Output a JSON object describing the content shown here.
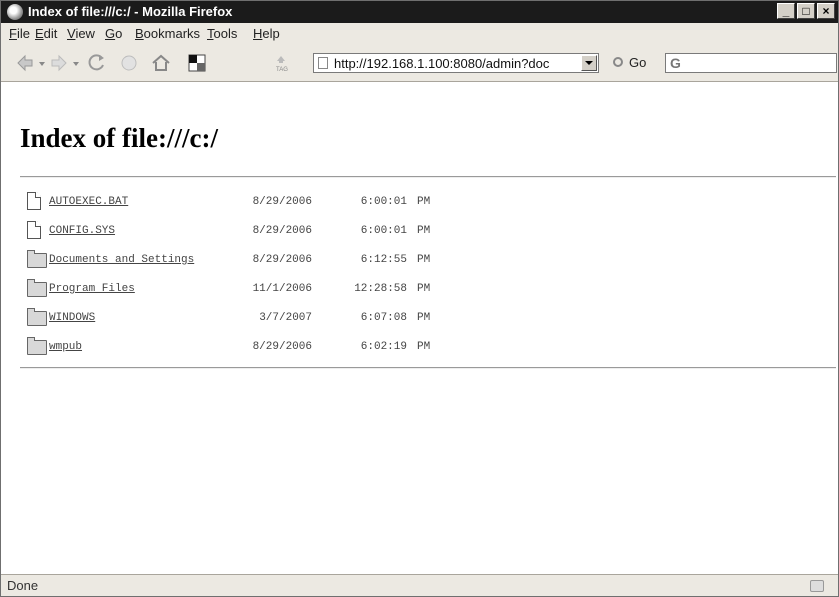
{
  "window": {
    "title": "Index of file:///c:/ - Mozilla Firefox",
    "controls": [
      "_",
      "□",
      "×"
    ]
  },
  "menubar": {
    "items": [
      {
        "first": "F",
        "rest": "ile"
      },
      {
        "first": "E",
        "rest": "dit"
      },
      {
        "first": "V",
        "rest": "iew"
      },
      {
        "first": "G",
        "rest": "o"
      },
      {
        "first": "B",
        "rest": "ookmarks"
      },
      {
        "first": "T",
        "rest": "ools"
      },
      {
        "first": "H",
        "rest": "elp"
      }
    ]
  },
  "navbar": {
    "url": "http://192.168.1.100:8080/admin?doc",
    "go_label": "Go",
    "search_glyph": "G",
    "tag_icon_label": "TAG"
  },
  "page": {
    "title": "Index of file:///c:/",
    "entries": [
      {
        "type": "file",
        "name": "AUTOEXEC.BAT",
        "date": "8/29/2006",
        "time": "6:00:01",
        "ampm": "PM"
      },
      {
        "type": "file",
        "name": "CONFIG.SYS",
        "date": "8/29/2006",
        "time": "6:00:01",
        "ampm": "PM"
      },
      {
        "type": "folder",
        "name": "Documents and Settings",
        "date": "8/29/2006",
        "time": "6:12:55",
        "ampm": "PM"
      },
      {
        "type": "folder",
        "name": "Program Files",
        "date": "11/1/2006",
        "time": "12:28:58",
        "ampm": "PM"
      },
      {
        "type": "folder",
        "name": "WINDOWS",
        "date": "3/7/2007",
        "time": "6:07:08",
        "ampm": "PM"
      },
      {
        "type": "folder",
        "name": "wmpub",
        "date": "8/29/2006",
        "time": "6:02:19",
        "ampm": "PM"
      }
    ]
  },
  "statusbar": {
    "text": "Done"
  }
}
